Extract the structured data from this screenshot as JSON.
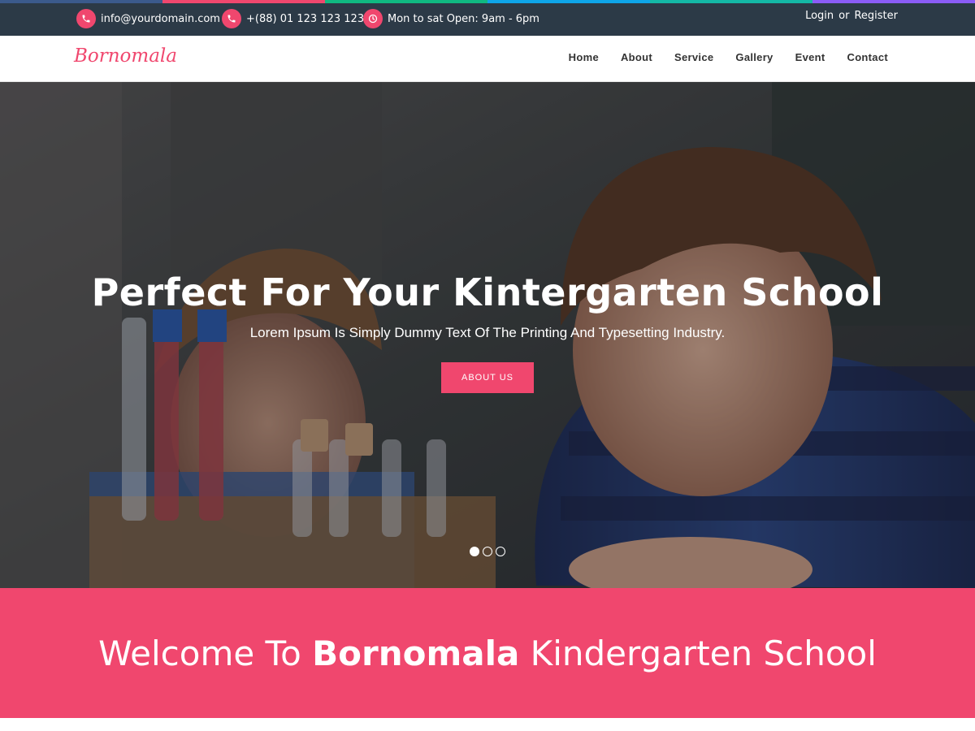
{
  "topbar": {
    "email": "info@yourdomain.com",
    "phone": "+(88) 01 123 123 123",
    "hours": "Mon to sat Open: 9am - 6pm",
    "login": "Login",
    "or": "or",
    "register": "Register",
    "stripe_colors": [
      "#3b5a8c",
      "#f0476e",
      "#10b981",
      "#0ea5e9",
      "#14b8a6",
      "#8b5cf6"
    ]
  },
  "nav": {
    "brand": "Bornomala",
    "items": [
      "Home",
      "About",
      "Service",
      "Gallery",
      "Event",
      "Contact"
    ]
  },
  "hero": {
    "title": "Perfect For Your Kintergarten School",
    "subtitle": "Lorem Ipsum Is Simply Dummy Text Of The Printing And Typesetting Industry.",
    "button": "ABOUT US",
    "slides": {
      "count": 3,
      "active": 1
    }
  },
  "welcome": {
    "prefix": "Welcome To",
    "brand": "Bornomala",
    "suffix": "Kindergarten School"
  },
  "colors": {
    "accent": "#f0476e",
    "topbar": "#2c3a47"
  }
}
